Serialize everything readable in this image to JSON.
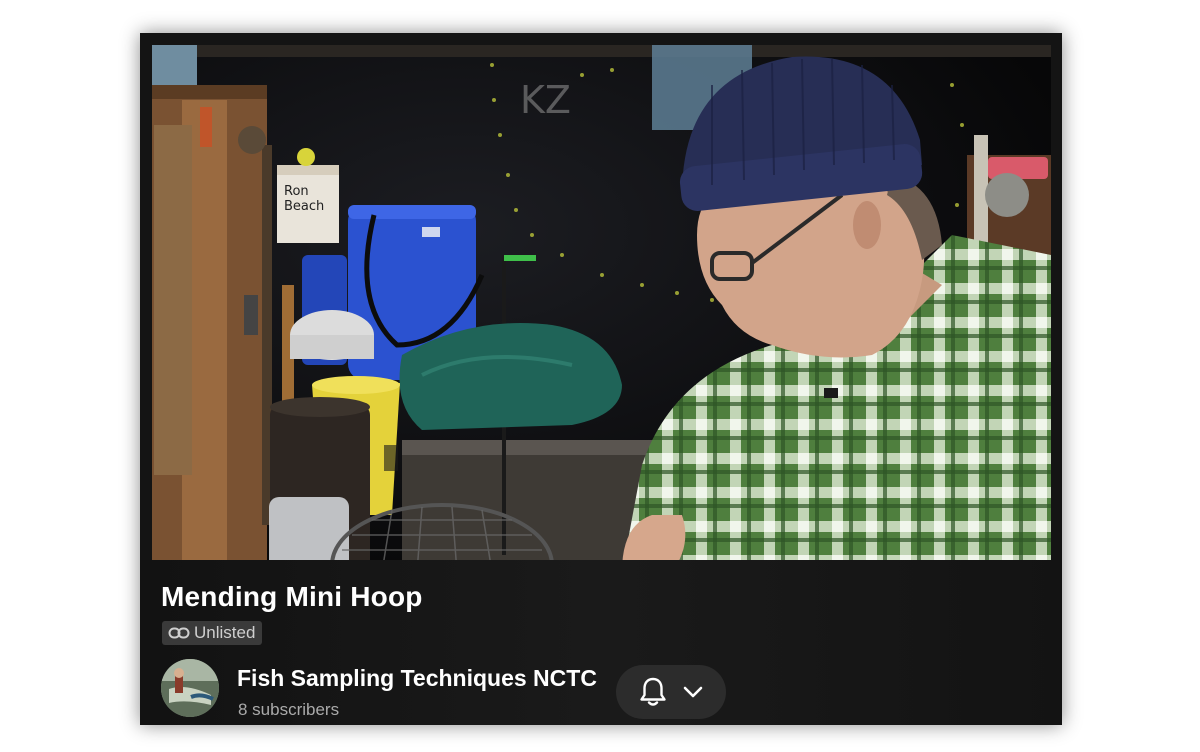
{
  "video": {
    "title": "Mending Mini Hoop",
    "visibility": "Unlisted",
    "scene_signs": {
      "line1": "Ron",
      "line2": "Beach"
    },
    "scene_wall_letters": "KZ"
  },
  "channel": {
    "name": "Fish Sampling Techniques NCTC",
    "subscribers": "8 subscribers"
  },
  "icons": {
    "visibility": "link-icon",
    "notification": "bell-icon",
    "menu": "chevron-down-icon"
  },
  "colors": {
    "background": "#141414",
    "text_primary": "#ffffff",
    "text_secondary": "#aaaaaa",
    "badge_bg": "#3a3a3a",
    "button_bg": "#2c2c2c"
  }
}
